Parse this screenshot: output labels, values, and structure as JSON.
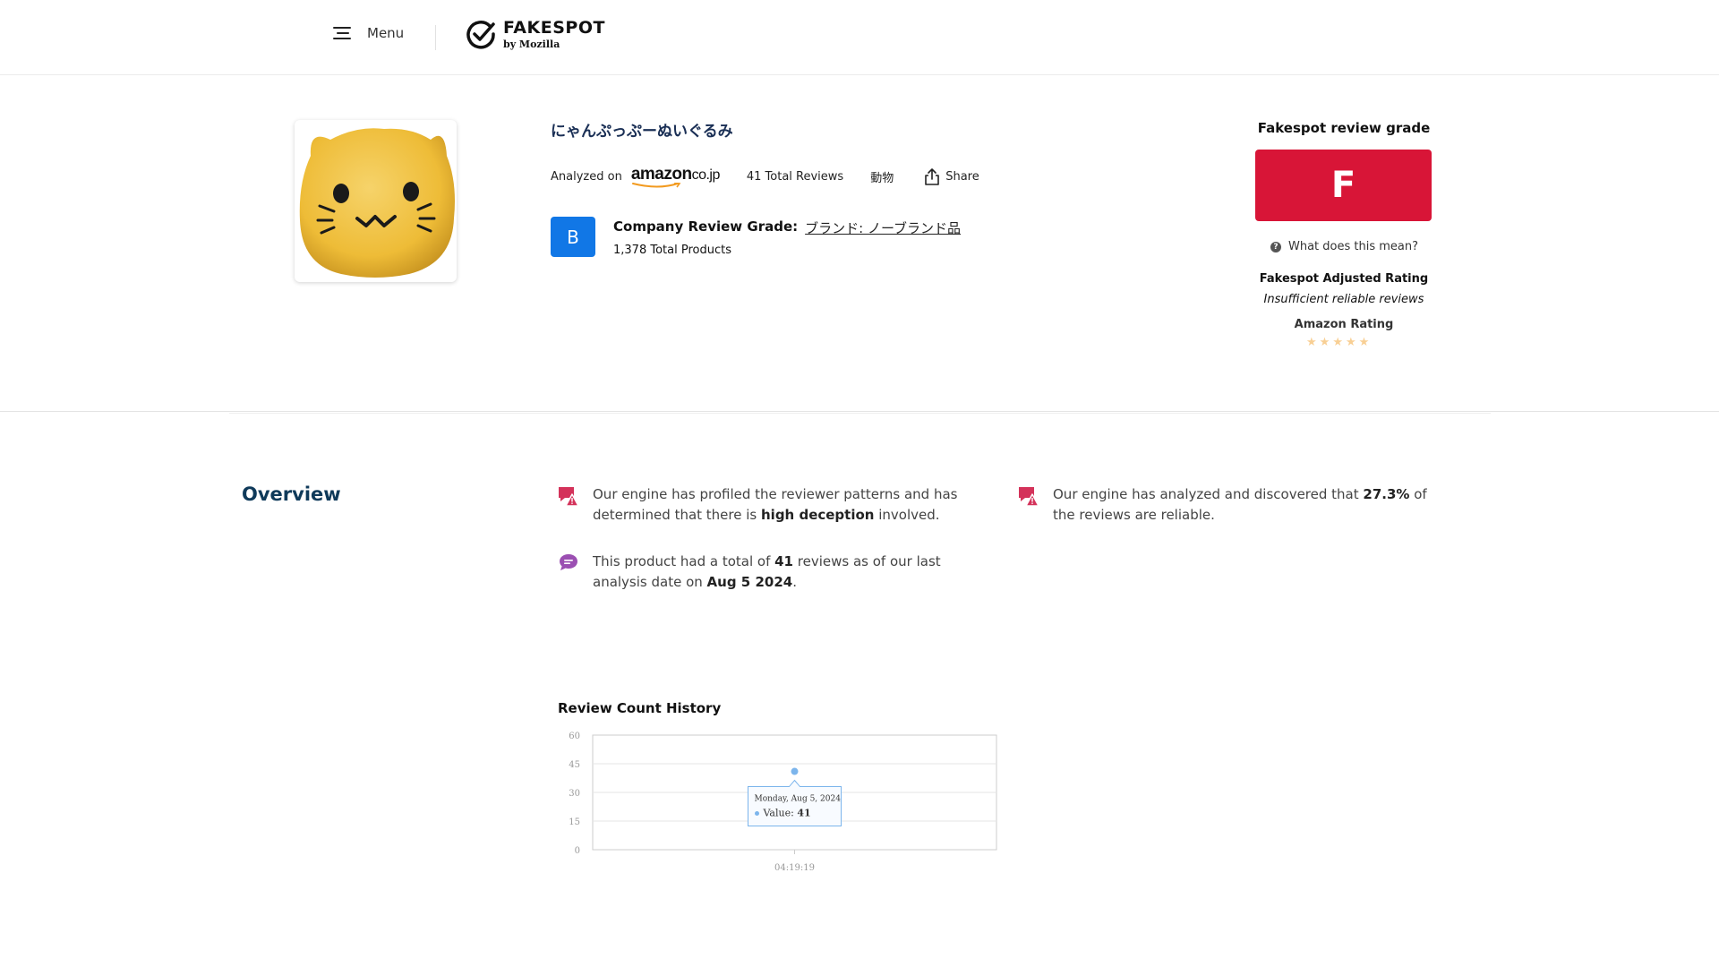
{
  "header": {
    "menu_label": "Menu",
    "logo_title": "FAKESPOT",
    "logo_sub": "by Mozilla"
  },
  "product": {
    "title": "にゃんぷっぷーぬいぐるみ",
    "analyzed_on": "Analyzed on",
    "marketplace": "amazon",
    "marketplace_suffix": "co.jp",
    "total_reviews": "41 Total Reviews",
    "category": "動物",
    "share_label": "Share",
    "image_icon": "cat-plush-image"
  },
  "company": {
    "grade": "B",
    "label": "Company Review Grade:",
    "brand": "ブランド: ノーブランド品",
    "total_products": "1,378  Total Products",
    "grade_color": "#1177e6"
  },
  "grade_panel": {
    "title": "Fakespot review grade",
    "grade": "F",
    "grade_color": "#d81537",
    "what_means": "What does this mean?",
    "adjusted_title": "Fakespot Adjusted Rating",
    "adjusted_value": "Insufficient reliable reviews",
    "amazon_rating_title": "Amazon Rating",
    "amazon_rating_stars": 5,
    "star_color": "#f8cf94"
  },
  "overview": {
    "title": "Overview",
    "insight1": {
      "text_a": "Our engine has profiled the reviewer patterns and has determined that there is ",
      "bold": "high deception",
      "text_b": " involved."
    },
    "insight2": {
      "text_a": "Our engine has analyzed and discovered that ",
      "bold": "27.3%",
      "text_b": " of the reviews are reliable."
    },
    "insight3": {
      "text_a": "This product had a total of ",
      "bold1": "41",
      "text_b": " reviews as of our last analysis date on ",
      "bold2": "Aug 5 2024",
      "text_c": "."
    }
  },
  "chart_title": "Review Count History",
  "chart_data": {
    "type": "scatter",
    "title": "Review Count History",
    "x": [
      "04:19:19"
    ],
    "values": [
      41
    ],
    "yticks": [
      0,
      15,
      30,
      45,
      60
    ],
    "ylim": [
      0,
      60
    ],
    "grid": true,
    "series_color": "#7cb5ec",
    "tooltip": {
      "date": "Monday, Aug 5, 2024",
      "label": "Value:",
      "value": "41"
    }
  }
}
